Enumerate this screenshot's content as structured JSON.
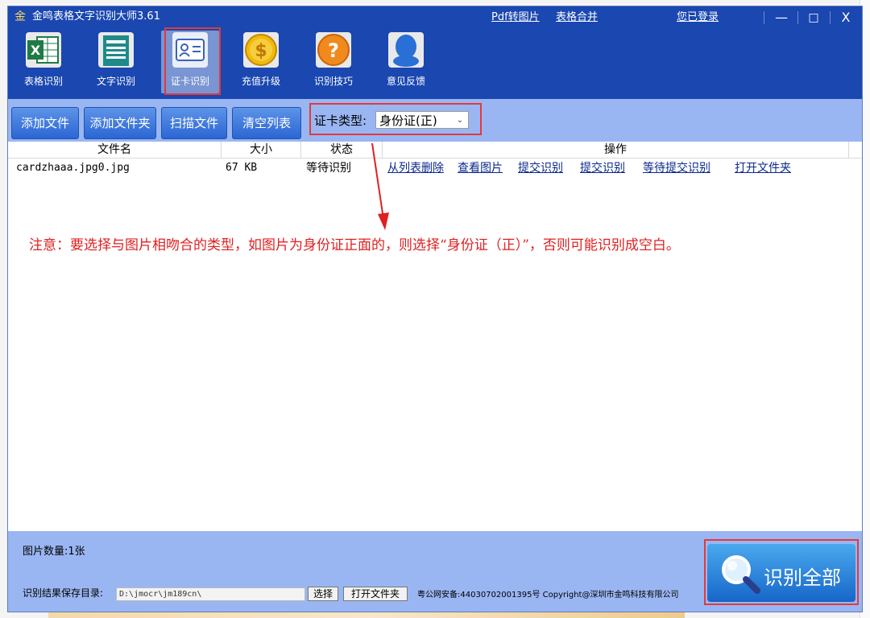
{
  "window": {
    "logo_char": "金",
    "title": "金鸣表格文字识别大师3.61",
    "links": [
      "Pdf转图片",
      "表格合并",
      "您已登录"
    ],
    "controls": {
      "minimize": "—",
      "maximize": "□",
      "close": "X"
    }
  },
  "tools": [
    {
      "label": "表格识别",
      "icon": "excel-icon"
    },
    {
      "label": "文字识别",
      "icon": "document-icon"
    },
    {
      "label": "证卡识别",
      "icon": "id-card-icon",
      "selected": true
    },
    {
      "label": "充值升级",
      "icon": "coin-icon"
    },
    {
      "label": "识别技巧",
      "icon": "help-icon"
    },
    {
      "label": "意见反馈",
      "icon": "feedback-icon"
    }
  ],
  "actions": {
    "add_file": "添加文件",
    "add_folder": "添加文件夹",
    "scan_file": "扫描文件",
    "clear_list": "清空列表"
  },
  "card_type": {
    "label": "证卡类型:",
    "value": "身份证(正)"
  },
  "table": {
    "headers": [
      "文件名",
      "大小",
      "状态",
      "操作"
    ],
    "rows": [
      {
        "filename": "cardzhaaa.jpg0.jpg",
        "size": "67 KB",
        "status": "等待识别",
        "ops": [
          "从列表删除",
          "查看图片",
          "提交识别",
          "提交识别",
          "等待提交识别",
          "打开文件夹"
        ]
      }
    ]
  },
  "note": "注意：要选择与图片相吻合的类型，如图片为身份证正面的，则选择“身份证（正）”，否则可能识别成空白。",
  "footer": {
    "count": "图片数量:1张",
    "dir_label": "识别结果保存目录:",
    "dir_value": "D:\\jmocr\\jm189cn\\",
    "choose_btn": "选择",
    "open_folder_btn": "打开文件夹",
    "icp": "粤公网安备:44030702001395号  Copyright@深圳市金鸣科技有限公司",
    "recognize_all": "识别全部"
  },
  "colors": {
    "titlebar": "#1a47b0",
    "toolbar": "#9ab6f2",
    "note": "#e02020"
  }
}
